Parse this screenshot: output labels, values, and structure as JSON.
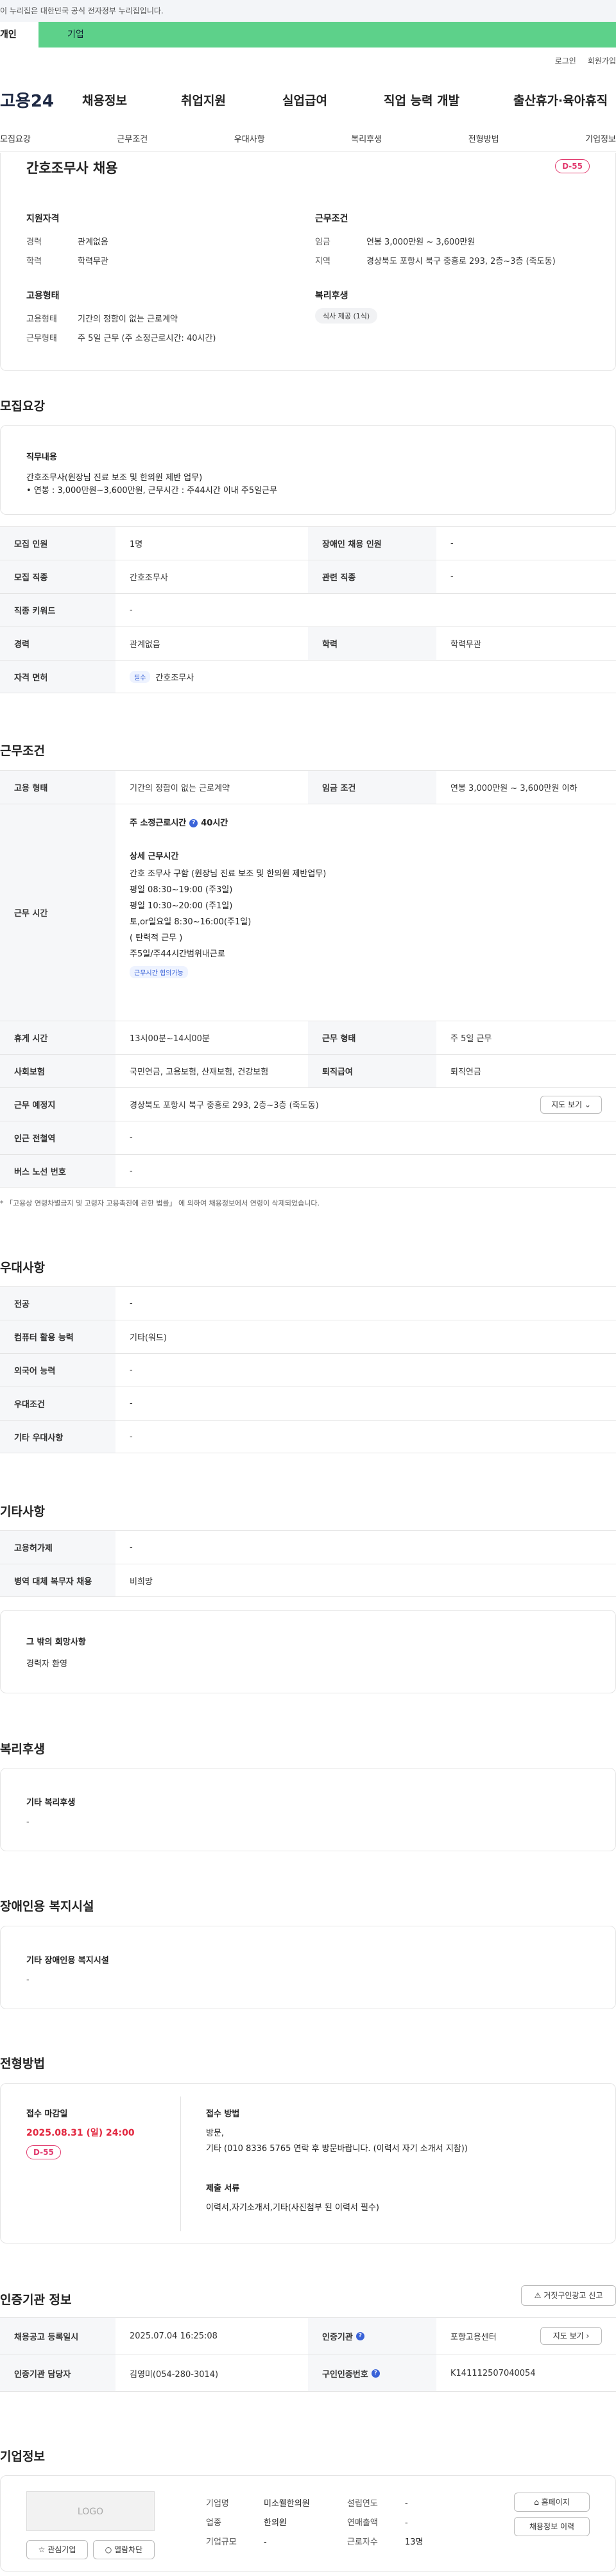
{
  "gov_banner": "이 누리집은 대한민국 공식 전자정부 누리집입니다.",
  "top_tabs": [
    "개인",
    "기업"
  ],
  "util": [
    "로그인",
    "회원가입"
  ],
  "logo": "고용24",
  "gnb": [
    "채용정보",
    "취업지원",
    "실업급여",
    "직업 능력 개발",
    "출산휴가·육아휴직"
  ],
  "anchors": [
    "모집요강",
    "근무조건",
    "우대사항",
    "복리후생",
    "전형방법",
    "기업정보"
  ],
  "summary": {
    "title": "간호조무사 채용",
    "dday": "D-55",
    "qual_h": "지원자격",
    "career_k": "경력",
    "career_v": "관계없음",
    "edu_k": "학력",
    "edu_v": "학력무관",
    "emp_h": "고용형태",
    "emptype_k": "고용형태",
    "emptype_v": "기간의 정함이 없는 근로계약",
    "worktype_k": "근무형태",
    "worktype_v": "주 5일 근무 (주 소정근로시간: 40시간)",
    "cond_h": "근무조건",
    "wage_k": "임금",
    "wage_v": "연봉 3,000만원 ~ 3,600만원",
    "loc_k": "지역",
    "loc_v": "경상북도 포항시 북구 중흥로 293, 2층~3층 (죽도동)",
    "welfare_h": "복리후생",
    "welfare_v": "식사 제공 (1식)"
  },
  "recruit": {
    "title": "모집요강",
    "job_h": "직무내용",
    "job_l1": "간호조무사(원장님 진료 보조 및 한의원 제반 업무)",
    "job_l2": "• 연봉 : 3,000만원~3,600만원,  근무시간 : 주44시간 이내    주5일근무",
    "rows": [
      [
        "모집 인원",
        "1명",
        "장애인 채용 인원",
        "-"
      ],
      [
        "모집 직종",
        "간호조무사",
        "관련 직종",
        "-"
      ],
      [
        "직종 키워드",
        "-",
        "",
        ""
      ],
      [
        "경력",
        "관계없음",
        "학력",
        "학력무관"
      ],
      [
        "자격 면허",
        "필수",
        "간호조무사",
        ""
      ]
    ]
  },
  "cond": {
    "title": "근무조건",
    "emp_k": "고용 형태",
    "emp_v": "기간의 정함이 없는 근로계약",
    "wage_k": "임금 조건",
    "wage_v": "연봉 3,000만원 ~ 3,600만원 이하",
    "hours_k": "근무 시간",
    "hours_a": "주 소정근로시간",
    "hours_b": "40시간",
    "detail_h": "상세 근무시간",
    "detail": [
      "간호 조무사 구함 (원장님 진료 보조 및 한의원 제반업무)",
      "평일  08:30~19:00 (주3일)",
      "평일  10:30~20:00 (주1일)",
      "토,or일요일  8:30~16:00(주1일)",
      "  ( 탄력적 근무 )",
      "주5일/주44시간범위내근로"
    ],
    "hours_chip": "근무시간 협의가능",
    "rest_k": "휴게 시간",
    "rest_v": "13시00분~14시00분",
    "form_k": "근무 형태",
    "form_v": "주 5일 근무",
    "ins_k": "사회보험",
    "ins_v": "국민연금, 고용보험, 산재보험, 건강보험",
    "ret_k": "퇴직급여",
    "ret_v": "퇴직연금",
    "place_k": "근무 예정지",
    "place_v": "경상북도 포항시 북구 중흥로 293, 2층~3층 (죽도동)",
    "map_btn": "지도 보기",
    "subway_k": "인근 전철역",
    "subway_v": "-",
    "bus_k": "버스 노선 번호",
    "bus_v": "-",
    "note": "* 「고용상 연령차별금지 및 고령자 고용촉진에 관한 법률」 에 의하여 채용정보에서 연령이 삭제되었습니다."
  },
  "pref": {
    "title": "우대사항",
    "rows": [
      [
        "전공",
        "-"
      ],
      [
        "컴퓨터 활용 능력",
        "기타(워드)"
      ],
      [
        "외국어 능력",
        "-"
      ],
      [
        "우대조건",
        "-"
      ],
      [
        "기타 우대사항",
        "-"
      ]
    ]
  },
  "etc": {
    "title": "기타사항",
    "rows": [
      [
        "고용허가제",
        "-"
      ],
      [
        "병역 대체 복무자 채용",
        "비희망"
      ]
    ],
    "wish_h": "그 밖의 희망사항",
    "wish_v": "경력자   환영"
  },
  "welfare": {
    "title": "복리후생",
    "h": "기타 복리후생",
    "v": "-"
  },
  "disab": {
    "title": "장애인용 복지시설",
    "h": "기타 장애인용 복지시설",
    "v": "-"
  },
  "select": {
    "title": "전형방법",
    "deadline_h": "접수 마감일",
    "deadline_v": "2025.08.31 (일) 24:00",
    "dday": "D-55",
    "method_h": "접수 방법",
    "method_v1": "방문,",
    "method_v2": "기타 (010 8336 5765 연락 후 방문바랍니다. (이력서 자기 소개서 지참))",
    "docs_h": "제출 서류",
    "docs_v": "이력서,자기소개서,기타(사진첨부 된 이력서 필수)"
  },
  "agency": {
    "title": "인증기관 정보",
    "report_btn": "거짓구인광고 신고",
    "reg_k": "채용공고 등록일시",
    "reg_v": "2025.07.04 16:25:08",
    "org_k": "인증기관",
    "org_v": "포항고용센터",
    "map_btn": "지도 보기",
    "mgr_k": "인증기관 담당자",
    "mgr_v": "김영미(054-280-3014)",
    "cert_k": "구인인증번호",
    "cert_v": "K141112507040054"
  },
  "company": {
    "title": "기업정보",
    "logo": "LOGO",
    "name_k": "기업명",
    "name_v": "미소웰한의원",
    "year_k": "설립연도",
    "year_v": "-",
    "ind_k": "업종",
    "ind_v": "한의원",
    "sales_k": "연매출액",
    "sales_v": "-",
    "size_k": "기업규모",
    "size_v": "-",
    "emp_k": "근로자수",
    "emp_v": "13명",
    "home_btn": "홈페이지",
    "jobs_btn": "채용정보 이력",
    "fav_btn": "관심기업",
    "open_btn": "열람차단"
  }
}
